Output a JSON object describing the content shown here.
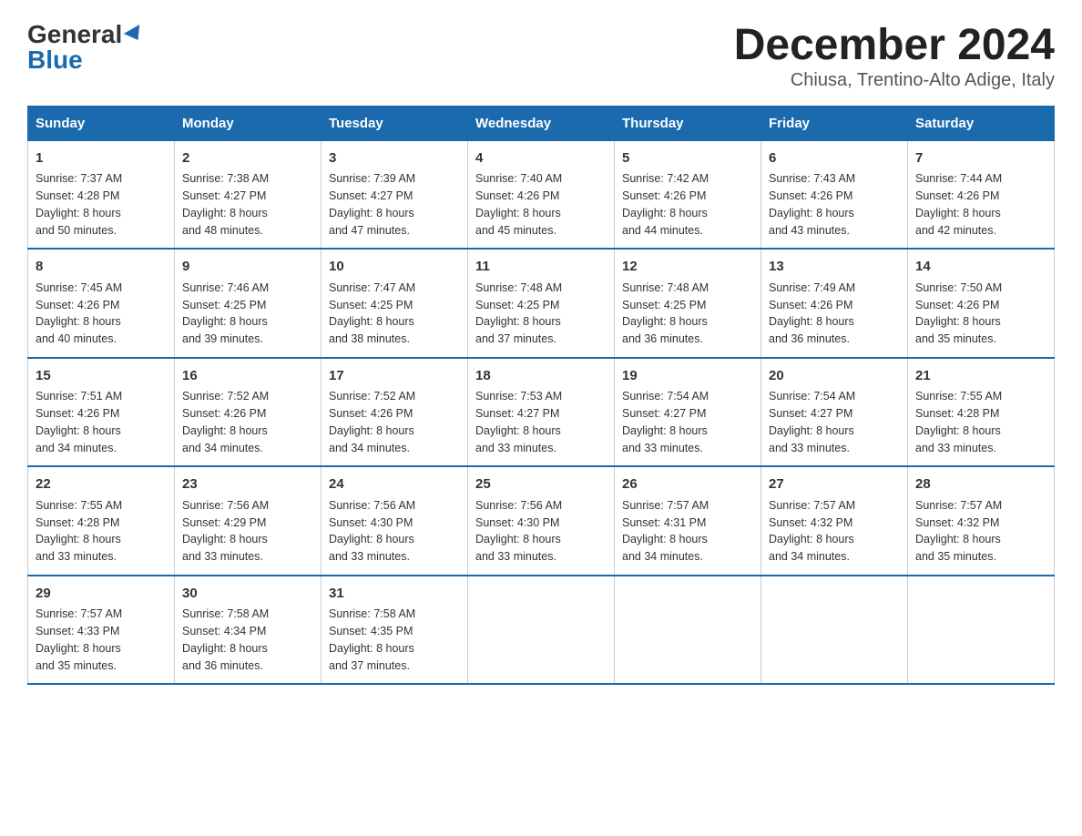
{
  "logo": {
    "general": "General",
    "blue": "Blue"
  },
  "title": "December 2024",
  "subtitle": "Chiusa, Trentino-Alto Adige, Italy",
  "days_of_week": [
    "Sunday",
    "Monday",
    "Tuesday",
    "Wednesday",
    "Thursday",
    "Friday",
    "Saturday"
  ],
  "weeks": [
    [
      {
        "day": "1",
        "sunrise": "7:37 AM",
        "sunset": "4:28 PM",
        "daylight": "8 hours and 50 minutes."
      },
      {
        "day": "2",
        "sunrise": "7:38 AM",
        "sunset": "4:27 PM",
        "daylight": "8 hours and 48 minutes."
      },
      {
        "day": "3",
        "sunrise": "7:39 AM",
        "sunset": "4:27 PM",
        "daylight": "8 hours and 47 minutes."
      },
      {
        "day": "4",
        "sunrise": "7:40 AM",
        "sunset": "4:26 PM",
        "daylight": "8 hours and 45 minutes."
      },
      {
        "day": "5",
        "sunrise": "7:42 AM",
        "sunset": "4:26 PM",
        "daylight": "8 hours and 44 minutes."
      },
      {
        "day": "6",
        "sunrise": "7:43 AM",
        "sunset": "4:26 PM",
        "daylight": "8 hours and 43 minutes."
      },
      {
        "day": "7",
        "sunrise": "7:44 AM",
        "sunset": "4:26 PM",
        "daylight": "8 hours and 42 minutes."
      }
    ],
    [
      {
        "day": "8",
        "sunrise": "7:45 AM",
        "sunset": "4:26 PM",
        "daylight": "8 hours and 40 minutes."
      },
      {
        "day": "9",
        "sunrise": "7:46 AM",
        "sunset": "4:25 PM",
        "daylight": "8 hours and 39 minutes."
      },
      {
        "day": "10",
        "sunrise": "7:47 AM",
        "sunset": "4:25 PM",
        "daylight": "8 hours and 38 minutes."
      },
      {
        "day": "11",
        "sunrise": "7:48 AM",
        "sunset": "4:25 PM",
        "daylight": "8 hours and 37 minutes."
      },
      {
        "day": "12",
        "sunrise": "7:48 AM",
        "sunset": "4:25 PM",
        "daylight": "8 hours and 36 minutes."
      },
      {
        "day": "13",
        "sunrise": "7:49 AM",
        "sunset": "4:26 PM",
        "daylight": "8 hours and 36 minutes."
      },
      {
        "day": "14",
        "sunrise": "7:50 AM",
        "sunset": "4:26 PM",
        "daylight": "8 hours and 35 minutes."
      }
    ],
    [
      {
        "day": "15",
        "sunrise": "7:51 AM",
        "sunset": "4:26 PM",
        "daylight": "8 hours and 34 minutes."
      },
      {
        "day": "16",
        "sunrise": "7:52 AM",
        "sunset": "4:26 PM",
        "daylight": "8 hours and 34 minutes."
      },
      {
        "day": "17",
        "sunrise": "7:52 AM",
        "sunset": "4:26 PM",
        "daylight": "8 hours and 34 minutes."
      },
      {
        "day": "18",
        "sunrise": "7:53 AM",
        "sunset": "4:27 PM",
        "daylight": "8 hours and 33 minutes."
      },
      {
        "day": "19",
        "sunrise": "7:54 AM",
        "sunset": "4:27 PM",
        "daylight": "8 hours and 33 minutes."
      },
      {
        "day": "20",
        "sunrise": "7:54 AM",
        "sunset": "4:27 PM",
        "daylight": "8 hours and 33 minutes."
      },
      {
        "day": "21",
        "sunrise": "7:55 AM",
        "sunset": "4:28 PM",
        "daylight": "8 hours and 33 minutes."
      }
    ],
    [
      {
        "day": "22",
        "sunrise": "7:55 AM",
        "sunset": "4:28 PM",
        "daylight": "8 hours and 33 minutes."
      },
      {
        "day": "23",
        "sunrise": "7:56 AM",
        "sunset": "4:29 PM",
        "daylight": "8 hours and 33 minutes."
      },
      {
        "day": "24",
        "sunrise": "7:56 AM",
        "sunset": "4:30 PM",
        "daylight": "8 hours and 33 minutes."
      },
      {
        "day": "25",
        "sunrise": "7:56 AM",
        "sunset": "4:30 PM",
        "daylight": "8 hours and 33 minutes."
      },
      {
        "day": "26",
        "sunrise": "7:57 AM",
        "sunset": "4:31 PM",
        "daylight": "8 hours and 34 minutes."
      },
      {
        "day": "27",
        "sunrise": "7:57 AM",
        "sunset": "4:32 PM",
        "daylight": "8 hours and 34 minutes."
      },
      {
        "day": "28",
        "sunrise": "7:57 AM",
        "sunset": "4:32 PM",
        "daylight": "8 hours and 35 minutes."
      }
    ],
    [
      {
        "day": "29",
        "sunrise": "7:57 AM",
        "sunset": "4:33 PM",
        "daylight": "8 hours and 35 minutes."
      },
      {
        "day": "30",
        "sunrise": "7:58 AM",
        "sunset": "4:34 PM",
        "daylight": "8 hours and 36 minutes."
      },
      {
        "day": "31",
        "sunrise": "7:58 AM",
        "sunset": "4:35 PM",
        "daylight": "8 hours and 37 minutes."
      },
      {
        "day": "",
        "sunrise": "",
        "sunset": "",
        "daylight": ""
      },
      {
        "day": "",
        "sunrise": "",
        "sunset": "",
        "daylight": ""
      },
      {
        "day": "",
        "sunrise": "",
        "sunset": "",
        "daylight": ""
      },
      {
        "day": "",
        "sunrise": "",
        "sunset": "",
        "daylight": ""
      }
    ]
  ],
  "labels": {
    "sunrise": "Sunrise:",
    "sunset": "Sunset:",
    "daylight": "Daylight:"
  }
}
